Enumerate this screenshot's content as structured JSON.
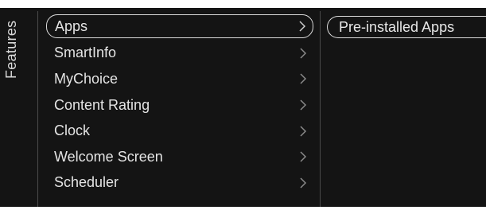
{
  "panel": {
    "title": "Features"
  },
  "menu": {
    "items": [
      {
        "label": "Apps",
        "selected": true
      },
      {
        "label": "SmartInfo",
        "selected": false
      },
      {
        "label": "MyChoice",
        "selected": false
      },
      {
        "label": "Content Rating",
        "selected": false
      },
      {
        "label": "Clock",
        "selected": false
      },
      {
        "label": "Welcome Screen",
        "selected": false
      },
      {
        "label": "Scheduler",
        "selected": false
      }
    ]
  },
  "submenu": {
    "items": [
      {
        "label": "Pre-installed Apps"
      }
    ]
  },
  "icons": {
    "chevron": "chevron-right-icon"
  },
  "colors": {
    "background": "#141414",
    "text": "#e4e4e4",
    "highlight_border": "#dcdcdc"
  }
}
